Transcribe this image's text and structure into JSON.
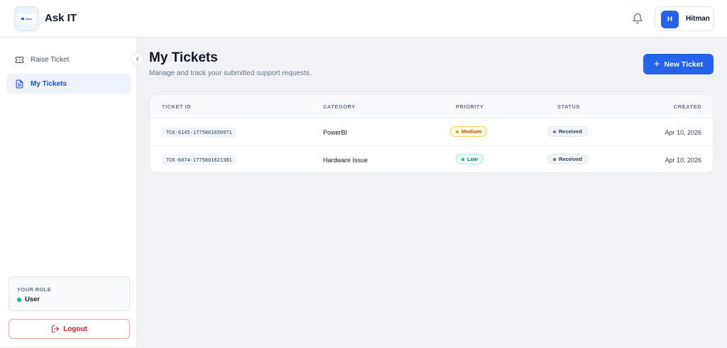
{
  "header": {
    "app_title": "Ask IT",
    "user": {
      "initial": "H",
      "name": "Hitman"
    }
  },
  "sidebar": {
    "items": [
      {
        "label": "Raise Ticket",
        "icon": "ticket-icon",
        "active": false
      },
      {
        "label": "My Tickets",
        "icon": "document-icon",
        "active": true
      }
    ],
    "role": {
      "label": "YOUR ROLE",
      "value": "User"
    },
    "logout_label": "Logout"
  },
  "main": {
    "title": "My Tickets",
    "subtitle": "Manage and track your submitted support requests.",
    "new_ticket_label": "New Ticket"
  },
  "table": {
    "columns": [
      "TICKET ID",
      "CATEGORY",
      "PRIORITY",
      "STATUS",
      "CREATED"
    ],
    "rows": [
      {
        "id": "TCK-6145-1775801650971",
        "category": "PowerBI",
        "priority": "Medium",
        "status": "Received",
        "created": "Apr 10, 2026"
      },
      {
        "id": "TCK-6074-1775801621381",
        "category": "Hardware Issue",
        "priority": "Low",
        "status": "Received",
        "created": "Apr 10, 2026"
      }
    ]
  },
  "colors": {
    "accent": "#2563eb",
    "priority_medium": "#f59e0b",
    "priority_low": "#14b8a6",
    "role_online": "#10b981",
    "logout": "#dc2626"
  }
}
